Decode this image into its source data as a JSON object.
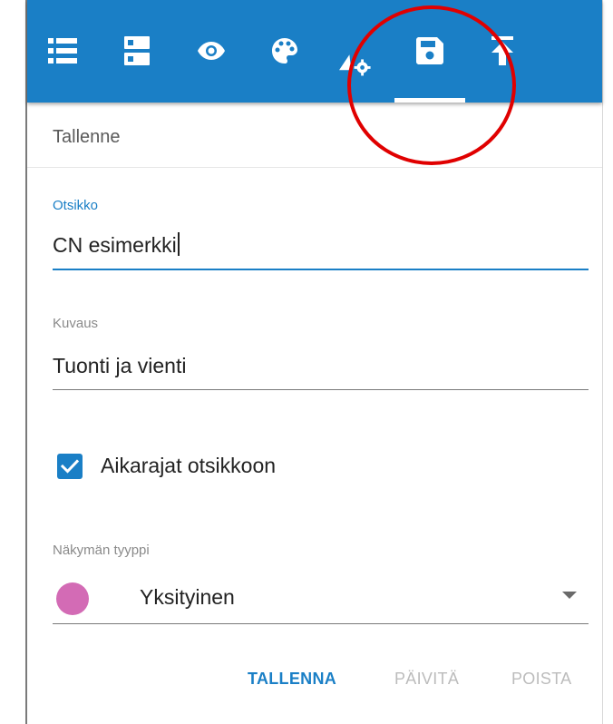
{
  "toolbar": {
    "background_color": "#1a7fc6",
    "tools": [
      {
        "icon": "list-icon",
        "active": false
      },
      {
        "icon": "server-icon",
        "active": false
      },
      {
        "icon": "eye-icon",
        "active": false
      },
      {
        "icon": "palette-icon",
        "active": false
      },
      {
        "icon": "axis-settings-icon",
        "active": false
      },
      {
        "icon": "save-icon",
        "active": true
      },
      {
        "icon": "upload-icon",
        "active": false
      }
    ]
  },
  "section": {
    "title": "Tallenne"
  },
  "form": {
    "title_field": {
      "label": "Otsikko",
      "value": "CN esimerkki"
    },
    "description_field": {
      "label": "Kuvaus",
      "value": "Tuonti ja vienti"
    },
    "time_limits_checkbox": {
      "label": "Aikarajat otsikkoon",
      "checked": true
    },
    "view_type": {
      "label": "Näkymän tyyppi",
      "value": "Yksityinen",
      "color": "#d36bb5"
    }
  },
  "actions": {
    "save_label": "TALLENNA",
    "update_label": "PÄIVITÄ",
    "delete_label": "POISTA"
  },
  "annotation": {
    "color": "#e00000"
  }
}
